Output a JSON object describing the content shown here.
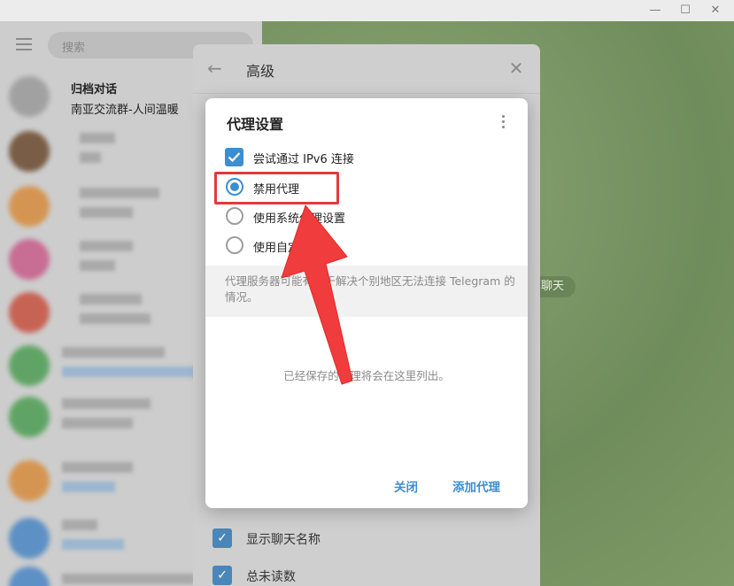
{
  "sidebar": {
    "search_placeholder": "搜索",
    "chats": [
      {
        "title": "归档对话",
        "preview": "南亚交流群-人间温暖"
      },
      {
        "title": "",
        "preview": ""
      },
      {
        "title": "",
        "preview": ""
      },
      {
        "title": "",
        "preview": ""
      },
      {
        "title": "",
        "preview": ""
      },
      {
        "title": "",
        "preview": ""
      },
      {
        "title": "",
        "preview": ""
      },
      {
        "title": "",
        "preview": ""
      },
      {
        "title": "",
        "preview": ""
      },
      {
        "title": "",
        "preview": ""
      }
    ]
  },
  "chat": {
    "pill": "聊天"
  },
  "settings": {
    "title": "高级",
    "options": [
      {
        "label": "显示聊天名称",
        "checked": true
      },
      {
        "label": "总未读数",
        "checked": true
      }
    ]
  },
  "dialog": {
    "title": "代理设置",
    "ipv6_label": "尝试通过 IPv6 连接",
    "ipv6_checked": true,
    "radios": [
      {
        "label": "禁用代理",
        "selected": true
      },
      {
        "label": "使用系统代理设置",
        "selected": false
      },
      {
        "label": "使用自定义代理",
        "selected": false
      }
    ],
    "note": "代理服务器可能有助于解决个别地区无法连接 Telegram 的情况。",
    "empty": "已经保存的代理将会在这里列出。",
    "close_label": "关闭",
    "add_label": "添加代理"
  },
  "colors": {
    "accent": "#3d8ecf",
    "highlight": "#e03a3a"
  }
}
